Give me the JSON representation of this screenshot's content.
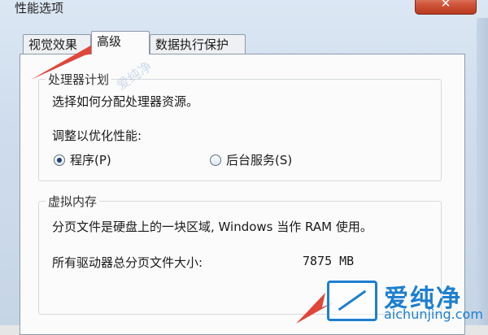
{
  "window": {
    "title": "性能选项"
  },
  "tabs": [
    {
      "label": "视觉效果"
    },
    {
      "label": "高级"
    },
    {
      "label": "数据执行保护"
    }
  ],
  "processor": {
    "legend": "处理器计划",
    "description": "选择如何分配处理器资源。",
    "adjust_label": "调整以优化性能:",
    "options": [
      {
        "label": "程序(P)",
        "checked": true
      },
      {
        "label": "后台服务(S)",
        "checked": false
      }
    ]
  },
  "virtual_memory": {
    "legend": "虚拟内存",
    "description": "分页文件是硬盘上的一块区域, Windows 当作 RAM 使用。",
    "total_label": "所有驱动器总分页文件大小:",
    "total_value": "7875 MB"
  },
  "watermark": {
    "brand": "爱纯净",
    "url": "aichunjing.com"
  },
  "colors": {
    "arrow": "#e0463a",
    "watermark": "#1d7fd0",
    "close_button": "#d0553a"
  }
}
